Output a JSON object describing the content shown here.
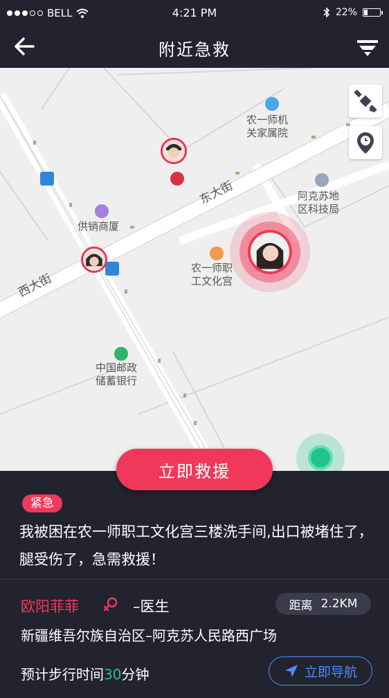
{
  "status": {
    "carrier": "BELL",
    "time": "4:21 PM",
    "battery": "22%"
  },
  "header": {
    "title": "附近急救"
  },
  "map": {
    "pois": [
      {
        "name": "农一师机关家属院",
        "line1": "农一师机",
        "line2": "关家属院"
      },
      {
        "name": "阿克苏地区科技局",
        "line1": "阿克苏地",
        "line2": "区科技局"
      },
      {
        "name": "供销商厦",
        "line1": "供销商厦"
      },
      {
        "name": "农一师职工文化宫",
        "line1": "农一师职",
        "line2": "工文化宫"
      },
      {
        "name": "中国邮政储蓄银行",
        "line1": "中国邮政",
        "line2": "储蓄银行"
      }
    ],
    "streets": [
      "东大街",
      "西大街"
    ]
  },
  "actions": {
    "rescue_label": "立即救援"
  },
  "request": {
    "tag": "紧急",
    "description": "我被困在农一师职工文化宫三楼洗手间,出口被堵住了，腿受伤了，急需救援！",
    "name": "欧阳菲菲",
    "role": "–医生",
    "distance_label": "距离",
    "distance_value": "2.2KM",
    "address": "新疆维吾尔族自治区–阿克苏人民路西广场",
    "walk_prefix": "预计步行时间",
    "walk_minutes": "30",
    "walk_suffix": "分钟",
    "navigate_label": "立即导航"
  },
  "colors": {
    "accent": "#f0395a",
    "dark": "#22232f",
    "green": "#22c28b",
    "blue": "#4a8ff5"
  },
  "icons": [
    "back-arrow-icon",
    "filter-icon",
    "satellite-icon",
    "clock-icon",
    "female-icon",
    "navigate-arrow-icon",
    "wifi-icon",
    "bluetooth-icon"
  ]
}
